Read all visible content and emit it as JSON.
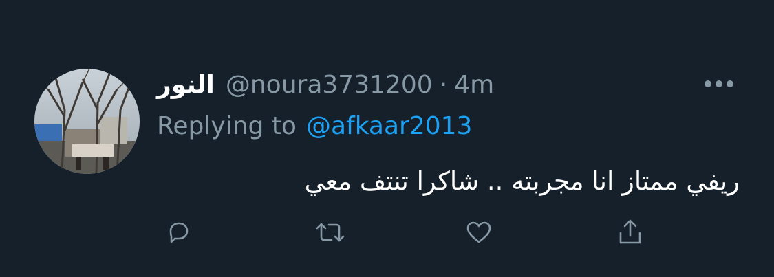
{
  "tweet": {
    "display_name": "النور",
    "handle": "@noura3731200",
    "separator": "·",
    "time": "4m",
    "reply_prefix": "Replying to",
    "reply_target": "@afkaar2013",
    "text": "ريفي ممتاز انا مجربته .. شاكرا تنتف معي"
  },
  "icons": {
    "more": "more-horizontal-icon",
    "reply": "reply-bubble-icon",
    "retweet": "retweet-icon",
    "like": "heart-icon",
    "share": "share-icon"
  },
  "colors": {
    "background": "#15202b",
    "secondary_text": "#8899a6",
    "link": "#1da1f2",
    "primary_text": "#ffffff"
  }
}
